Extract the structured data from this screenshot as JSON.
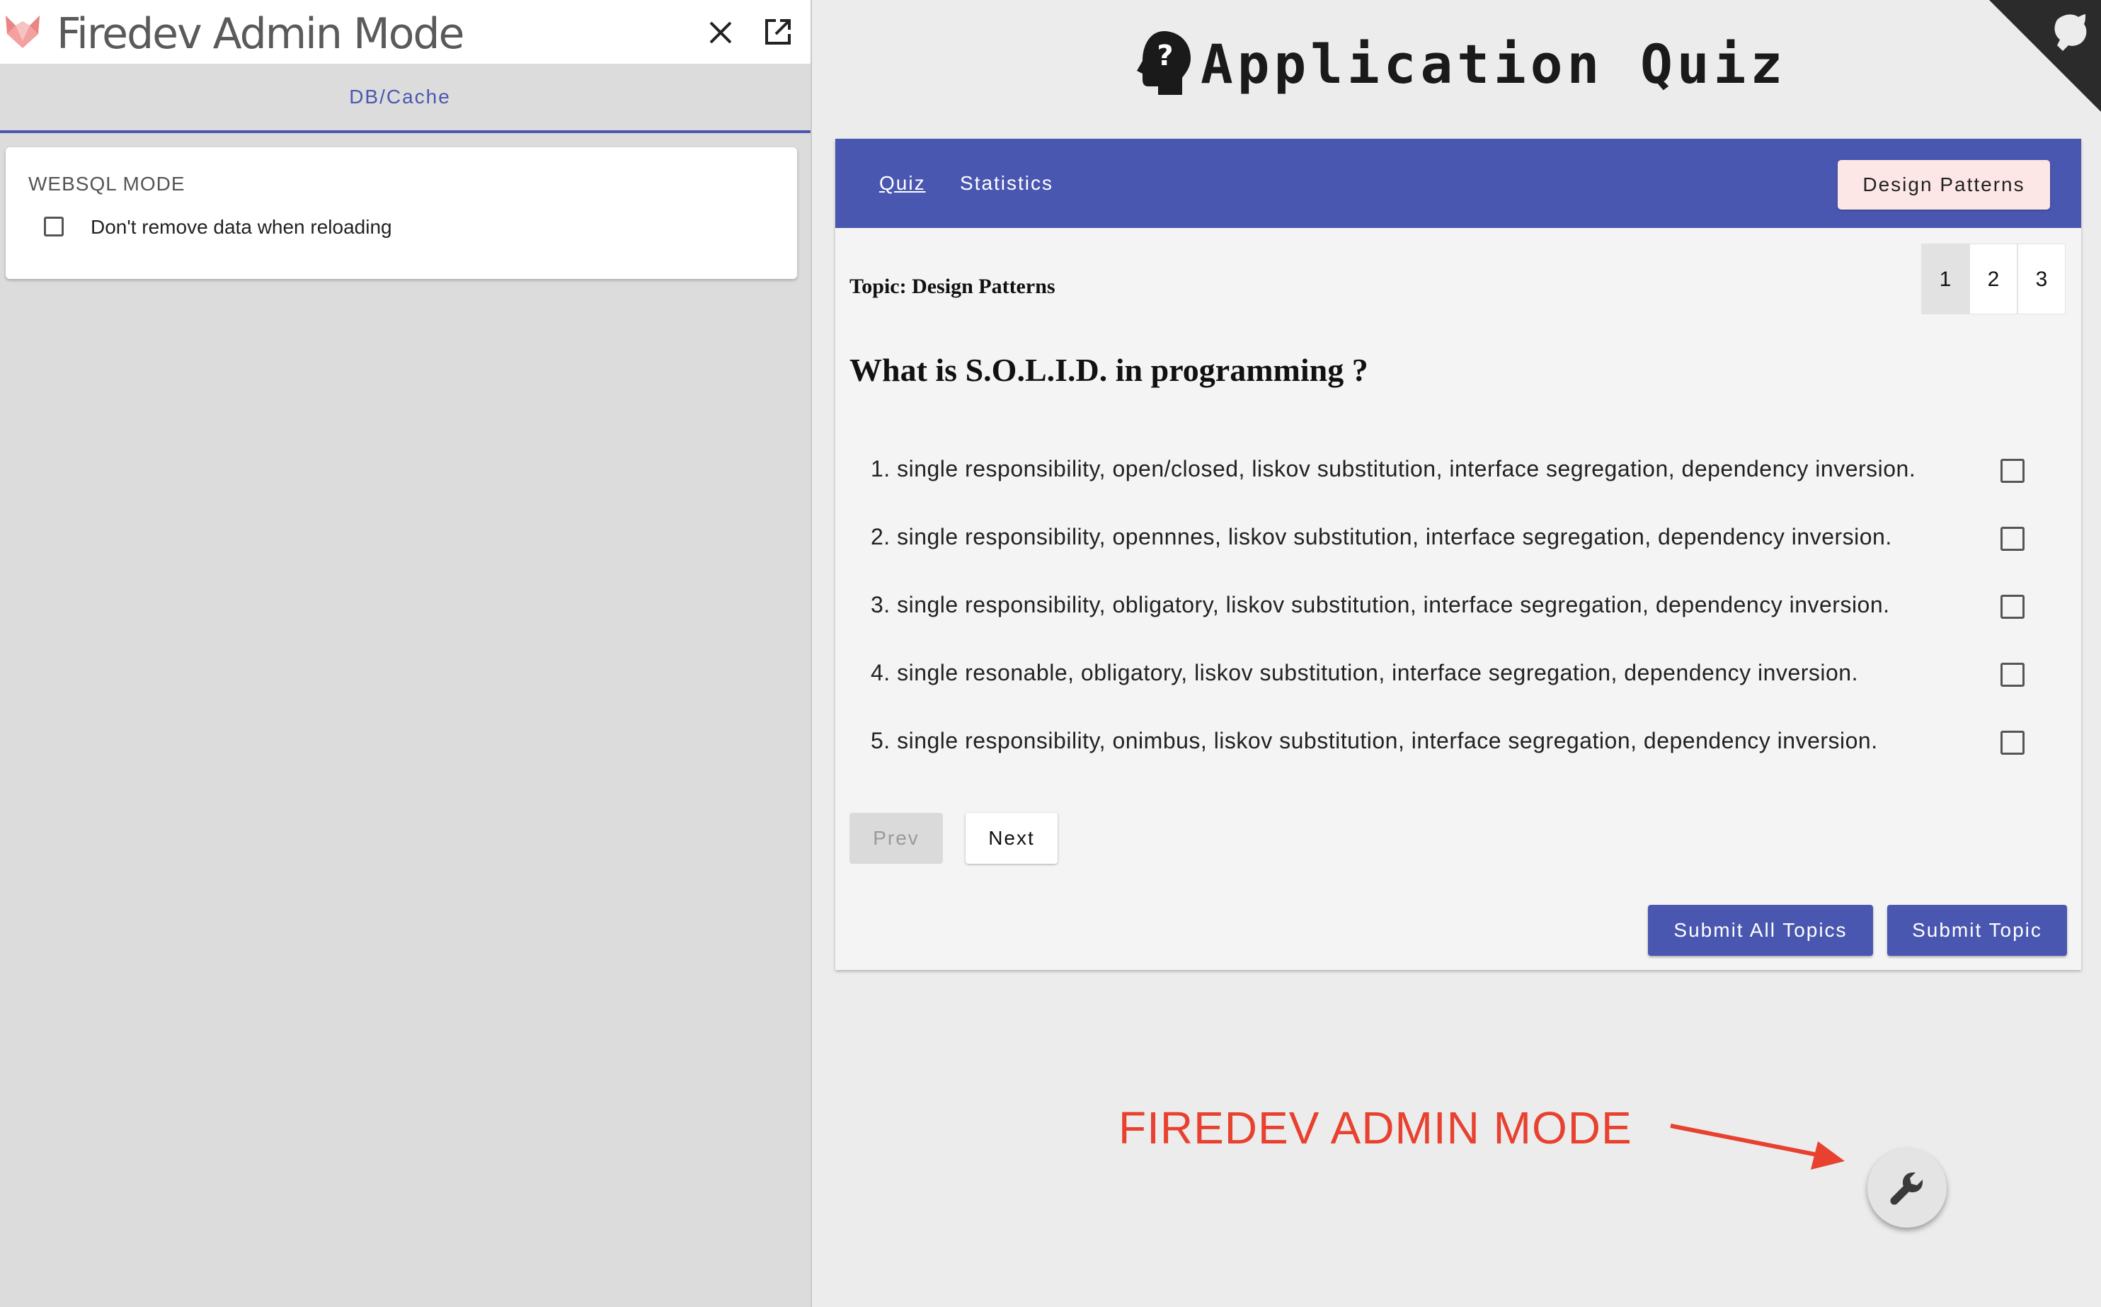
{
  "admin_panel": {
    "title": "Firedev Admin Mode",
    "logo_icon": "fox-logo-icon",
    "close_icon": "close-icon",
    "popout_icon": "open-in-new-icon",
    "tabs": [
      {
        "label": "DB/Cache",
        "active": true
      }
    ],
    "websql": {
      "title": "WEBSQL MODE",
      "checkbox_label": "Don't remove data when reloading",
      "checked": false
    }
  },
  "app": {
    "title": "Application Quiz",
    "logo_icon": "head-question-icon",
    "github_icon": "github-corner-icon"
  },
  "toolbar": {
    "nav": [
      {
        "label": "Quiz",
        "active": true
      },
      {
        "label": "Statistics",
        "active": false
      }
    ],
    "topic_button": "Design Patterns"
  },
  "quiz": {
    "topic_label": "Topic: Design Patterns",
    "pages": [
      "1",
      "2",
      "3"
    ],
    "active_page": "1",
    "question": "What is S.O.L.I.D. in programming ?",
    "answers": [
      "1. single responsibility, open/closed, liskov substitution, interface segregation, dependency inversion.",
      "2. single responsibility, opennnes, liskov substitution, interface segregation, dependency inversion.",
      "3. single responsibility, obligatory, liskov substitution, interface segregation, dependency inversion.",
      "4. single resonable, obligatory, liskov substitution, interface segregation, dependency inversion.",
      "5. single responsibility, onimbus, liskov substitution, interface segregation, dependency inversion."
    ],
    "prev_label": "Prev",
    "next_label": "Next",
    "submit_all_label": "Submit All Topics",
    "submit_topic_label": "Submit Topic"
  },
  "annotation": {
    "label": "FIREDEV ADMIN MODE",
    "color": "#e8412f"
  },
  "fab": {
    "icon": "wrench-icon"
  },
  "colors": {
    "primary": "#4a57b0",
    "topic_button_bg": "#fde6e6",
    "panel_bg": "#dcdcdc",
    "page_bg": "#ececec"
  }
}
